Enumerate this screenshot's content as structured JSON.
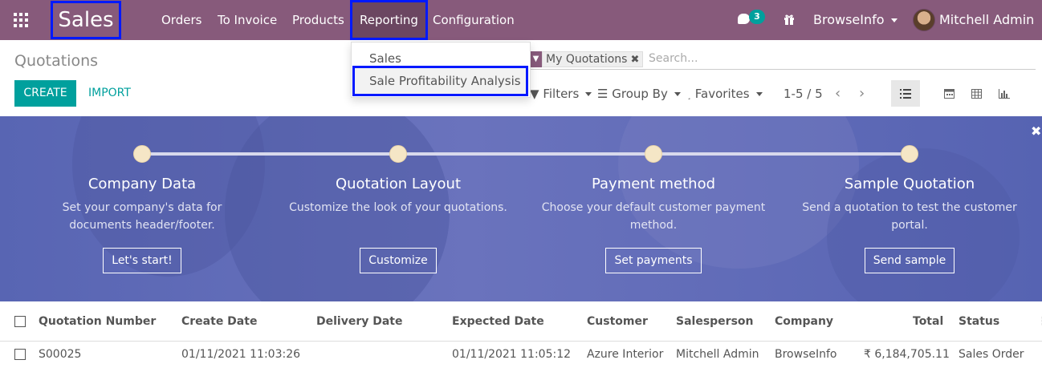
{
  "app": {
    "name": "Sales"
  },
  "nav": {
    "menu": [
      "Orders",
      "To Invoice",
      "Products",
      "Reporting",
      "Configuration"
    ],
    "active_menu": "Reporting",
    "messages_count": "3",
    "company": "BrowseInfo",
    "user": "Mitchell Admin"
  },
  "reporting_dropdown": {
    "items": [
      "Sales",
      "Sale Profitability Analysis"
    ]
  },
  "control_panel": {
    "title": "Quotations",
    "create_label": "CREATE",
    "import_label": "IMPORT",
    "facet": "My Quotations",
    "search_placeholder": "Search...",
    "filters_label": "Filters",
    "groupby_label": "Group By",
    "favorites_label": "Favorites",
    "pager": "1-5 / 5"
  },
  "onboarding": {
    "steps": [
      {
        "title": "Company Data",
        "desc": "Set your company's data for documents header/footer.",
        "button": "Let's start!"
      },
      {
        "title": "Quotation Layout",
        "desc": "Customize the look of your quotations.",
        "button": "Customize"
      },
      {
        "title": "Payment method",
        "desc": "Choose your default customer payment method.",
        "button": "Set payments"
      },
      {
        "title": "Sample Quotation",
        "desc": "Send a quotation to test the customer portal.",
        "button": "Send sample"
      }
    ]
  },
  "table": {
    "columns": [
      "Quotation Number",
      "Create Date",
      "Delivery Date",
      "Expected Date",
      "Customer",
      "Salesperson",
      "Company",
      "Total",
      "Status"
    ],
    "rows": [
      {
        "number": "S00025",
        "create_date": "01/11/2021 11:03:26",
        "delivery_date": "",
        "expected_date": "01/11/2021 11:05:12",
        "customer": "Azure Interior",
        "salesperson": "Mitchell Admin",
        "company": "BrowseInfo",
        "total": "₹ 6,184,705.11",
        "status": "Sales Order"
      }
    ]
  },
  "colors": {
    "navbar": "#875a7b",
    "accent": "#00a09d",
    "highlight": "#0019ff",
    "banner": "#5865b3"
  }
}
